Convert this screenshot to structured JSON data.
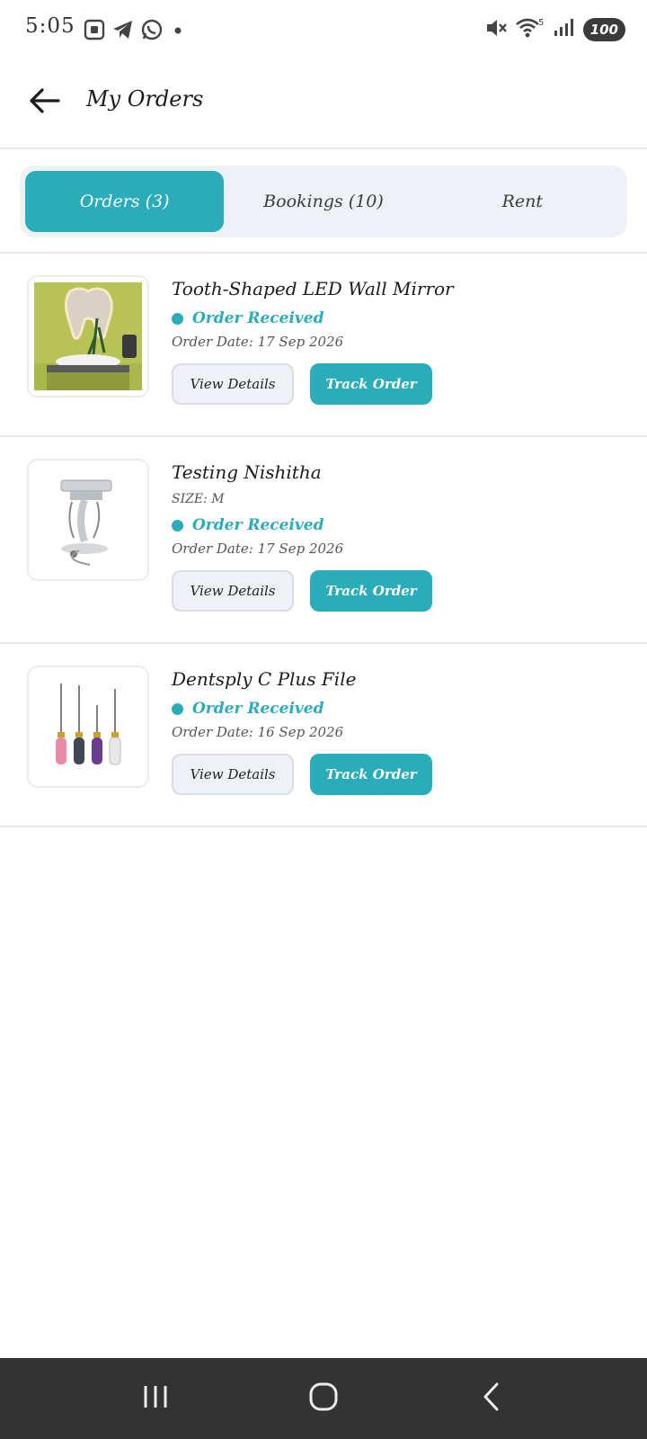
{
  "status_bar": {
    "time": "5:05",
    "battery": "100",
    "wifi_badge": "5"
  },
  "header": {
    "title": "My Orders"
  },
  "tabs": [
    {
      "label": "Orders (3)",
      "active": true
    },
    {
      "label": "Bookings (10)",
      "active": false
    },
    {
      "label": "Rent",
      "active": false
    }
  ],
  "orders": [
    {
      "name": "Tooth-Shaped LED Wall Mirror",
      "size": "",
      "status": "Order Received",
      "date": "Order Date: 17 Sep 2026",
      "view_label": "View Details",
      "track_label": "Track Order",
      "image": "tooth-mirror-image"
    },
    {
      "name": "Testing Nishitha",
      "size": "SIZE: M",
      "status": "Order Received",
      "date": "Order Date: 17 Sep 2026",
      "view_label": "View Details",
      "track_label": "Track Order",
      "image": "dental-cart-image"
    },
    {
      "name": "Dentsply C Plus File",
      "size": "",
      "status": "Order Received",
      "date": "Order Date: 16 Sep 2026",
      "view_label": "View Details",
      "track_label": "Track Order",
      "image": "endo-files-image"
    }
  ],
  "colors": {
    "accent": "#2aacba",
    "tab_background": "#eef1f5",
    "nav_bar": "#333333"
  },
  "icons": {
    "back": "arrow-left-icon",
    "nav_recents": "recents-icon",
    "nav_home": "home-icon",
    "nav_back": "back-chevron-icon"
  }
}
